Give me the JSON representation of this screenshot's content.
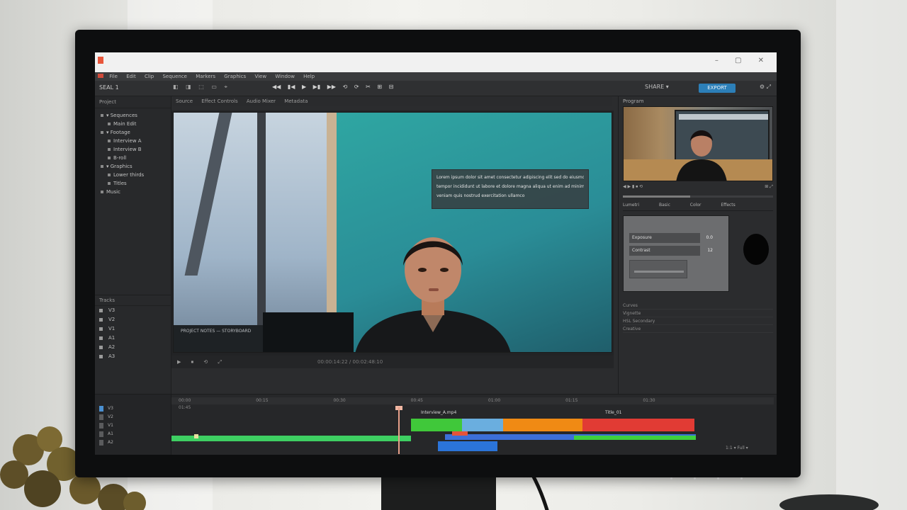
{
  "scene": {
    "colors": {
      "teal_background": "#2c9a9b",
      "accent_blue": "#2c7fb8",
      "clip_green": "#3ecf3e",
      "clip_blue": "#6aaedf",
      "clip_orange": "#f08a14",
      "clip_red": "#e13b34"
    }
  },
  "app": {
    "project_name": "SEAL 1",
    "share_label": "SHARE ▾",
    "export_label": "EXPORT",
    "window_controls": "– ▢ ✕"
  },
  "menu": {
    "items": [
      "File",
      "Edit",
      "Clip",
      "Sequence",
      "Markers",
      "Graphics",
      "View",
      "Window",
      "Help"
    ]
  },
  "toolbar": {
    "tools": [
      "◧",
      "◨",
      "⬚",
      "▭",
      "⌖"
    ],
    "center_tools": [
      "◀◀",
      "▮◀",
      "▶",
      "▶▮",
      "▶▶",
      "⟲",
      "⟳",
      "✂",
      "⊞",
      "⊟"
    ],
    "right_icons": "⚙ ⤢"
  },
  "subbar": {
    "items": [
      "Source",
      "Effect Controls",
      "Audio Mixer",
      "Metadata"
    ]
  },
  "left_panel": {
    "header": "Project",
    "tree": [
      {
        "label": "▾ Sequences",
        "indent": 2
      },
      {
        "label": "Main Edit",
        "indent": 4
      },
      {
        "label": "▾ Footage",
        "indent": 2
      },
      {
        "label": "Interview A",
        "indent": 4
      },
      {
        "label": "Interview B",
        "indent": 4
      },
      {
        "label": "B-roll",
        "indent": 4
      },
      {
        "label": "▾ Graphics",
        "indent": 2
      },
      {
        "label": "Lower thirds",
        "indent": 4
      },
      {
        "label": "Titles",
        "indent": 4
      },
      {
        "label": "Music",
        "indent": 2
      }
    ],
    "bottom_header": "Tracks",
    "tracks": [
      "V3",
      "V2",
      "V1",
      "A1",
      "A2",
      "A3"
    ]
  },
  "viewer": {
    "overlay_lines": [
      "Lorem ipsum dolor sit amet consectetur adipiscing elit sed do eiusmod",
      "tempor incididunt ut labore et dolore magna aliqua ut enim ad minim",
      "veniam quis nostrud exercitation ullamco"
    ],
    "shelf_text": "PROJECT NOTES — STORYBOARD",
    "controls": [
      "▶",
      "⏹",
      "⟲",
      "⤢"
    ],
    "timecode": "00:00:14:22 / 00:02:48:10"
  },
  "right_panel": {
    "header": "Program",
    "transport_left": "◀ ▶ ▮ ⏹ ⟲",
    "transport_right": "⊞ ⤢",
    "playback_fraction": 0.45,
    "tabs": [
      "Lumetri",
      "Basic",
      "Color",
      "Effects"
    ],
    "inspector_fields": [
      {
        "label": "Exposure",
        "value": "0.0"
      },
      {
        "label": "Contrast",
        "value": "12"
      }
    ],
    "list_rows": [
      "Curves",
      "Vignette",
      "HSL Secondary",
      "Creative"
    ]
  },
  "timeline": {
    "ruler": [
      "00:00",
      "00:15",
      "00:30",
      "00:45",
      "01:00",
      "01:15",
      "01:30",
      "01:45"
    ],
    "track_labels": [
      "V3",
      "V2",
      "V1",
      "A1",
      "A2"
    ],
    "clip_labels": [
      "Interview_A.mp4",
      "Title_01"
    ],
    "footer": "1:1 ▾  Full ▾"
  }
}
